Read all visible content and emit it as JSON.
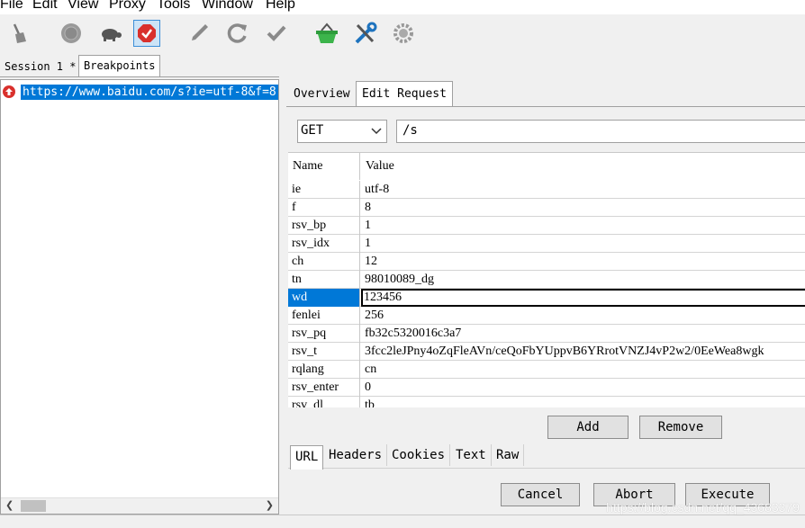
{
  "menu": [
    "File",
    "Edit",
    "View",
    "Proxy",
    "Tools",
    "Window",
    "Help"
  ],
  "toolbar": {
    "icons": [
      "broom-icon",
      "record-icon",
      "turtle-icon",
      "breakpoint-icon",
      "pen-icon",
      "refresh-icon",
      "check-icon",
      "basket-icon",
      "tools-icon",
      "gear-icon"
    ]
  },
  "session_tabs": {
    "session": "Session 1 *",
    "breakpoints": "Breakpoints"
  },
  "request_list": {
    "url": "https://www.baidu.com/s?ie=utf-8&f=8"
  },
  "right_tabs": {
    "overview": "Overview",
    "edit_request": "Edit Request"
  },
  "edit_request": {
    "method": "GET",
    "path": "/s",
    "columns": [
      "Name",
      "Value"
    ],
    "params": [
      {
        "name": "ie",
        "value": "utf-8"
      },
      {
        "name": "f",
        "value": "8"
      },
      {
        "name": "rsv_bp",
        "value": "1"
      },
      {
        "name": "rsv_idx",
        "value": "1"
      },
      {
        "name": "ch",
        "value": "12"
      },
      {
        "name": "tn",
        "value": "98010089_dg"
      },
      {
        "name": "wd",
        "value": "123456"
      },
      {
        "name": "fenlei",
        "value": "256"
      },
      {
        "name": "rsv_pq",
        "value": "fb32c5320016c3a7"
      },
      {
        "name": "rsv_t",
        "value": "3fcc2leJPny4oZqFleAVn/ceQoFbYUppvB6YRrotVNZJ4vP2w2/0EeWea8wgk"
      },
      {
        "name": "rqlang",
        "value": "cn"
      },
      {
        "name": "rsv_enter",
        "value": "0"
      },
      {
        "name": "rsv_dl",
        "value": "tb"
      }
    ],
    "selected_param": "wd",
    "add_label": "Add",
    "remove_label": "Remove",
    "subtabs": [
      "URL",
      "Headers",
      "Cookies",
      "Text",
      "Raw"
    ],
    "cancel_label": "Cancel",
    "abort_label": "Abort",
    "execute_label": "Execute"
  },
  "watermark": "https://blog.csdn.net/qq_43683379"
}
